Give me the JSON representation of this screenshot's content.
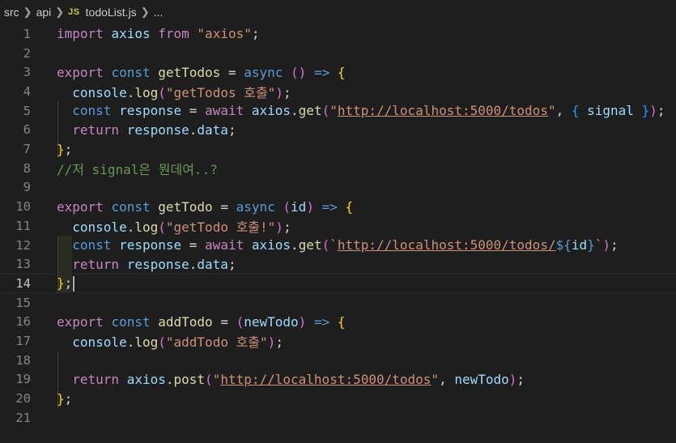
{
  "breadcrumb": {
    "segments": [
      "src",
      "api",
      "todoList.js",
      "..."
    ],
    "file_icon": "JS"
  },
  "editor": {
    "current_line": 14,
    "lines": [
      {
        "n": "1"
      },
      {
        "n": "2"
      },
      {
        "n": "3"
      },
      {
        "n": "4"
      },
      {
        "n": "5"
      },
      {
        "n": "6"
      },
      {
        "n": "7"
      },
      {
        "n": "8"
      },
      {
        "n": "9"
      },
      {
        "n": "10"
      },
      {
        "n": "11"
      },
      {
        "n": "12"
      },
      {
        "n": "13"
      },
      {
        "n": "14"
      },
      {
        "n": "15"
      },
      {
        "n": "16"
      },
      {
        "n": "17"
      },
      {
        "n": "18"
      },
      {
        "n": "19"
      },
      {
        "n": "20"
      },
      {
        "n": "21"
      }
    ],
    "code": [
      [
        [
          "kw-ctl",
          "import"
        ],
        [
          "op",
          " "
        ],
        [
          "var",
          "axios"
        ],
        [
          "op",
          " "
        ],
        [
          "kw-ctl",
          "from"
        ],
        [
          "op",
          " "
        ],
        [
          "str",
          "\"axios\""
        ],
        [
          "op",
          ";"
        ]
      ],
      [],
      [
        [
          "kw-ctl",
          "export"
        ],
        [
          "op",
          " "
        ],
        [
          "kw",
          "const"
        ],
        [
          "op",
          " "
        ],
        [
          "fn",
          "getTodos"
        ],
        [
          "op",
          " = "
        ],
        [
          "kw",
          "async"
        ],
        [
          "op",
          " "
        ],
        [
          "b2",
          "()"
        ],
        [
          "op",
          " "
        ],
        [
          "kw",
          "=>"
        ],
        [
          "op",
          " "
        ],
        [
          "b1",
          "{"
        ]
      ],
      [
        [
          "op",
          "  "
        ],
        [
          "var",
          "console"
        ],
        [
          "op",
          "."
        ],
        [
          "fn",
          "log"
        ],
        [
          "b2",
          "("
        ],
        [
          "str",
          "\"getTodos 호출\""
        ],
        [
          "b2",
          ")"
        ],
        [
          "op",
          ";"
        ]
      ],
      [
        [
          "op",
          "  "
        ],
        [
          "kw",
          "const"
        ],
        [
          "op",
          " "
        ],
        [
          "var",
          "response"
        ],
        [
          "op",
          " = "
        ],
        [
          "kw-ctl",
          "await"
        ],
        [
          "op",
          " "
        ],
        [
          "var",
          "axios"
        ],
        [
          "op",
          "."
        ],
        [
          "fn",
          "get"
        ],
        [
          "b2",
          "("
        ],
        [
          "str",
          "\""
        ],
        [
          "url",
          "http://localhost:5000/todos"
        ],
        [
          "str",
          "\""
        ],
        [
          "op",
          ", "
        ],
        [
          "b3",
          "{"
        ],
        [
          "op",
          " "
        ],
        [
          "var",
          "signal"
        ],
        [
          "op",
          " "
        ],
        [
          "b3",
          "}"
        ],
        [
          "b2",
          ")"
        ],
        [
          "op",
          ";"
        ]
      ],
      [
        [
          "op",
          "  "
        ],
        [
          "kw-ctl",
          "return"
        ],
        [
          "op",
          " "
        ],
        [
          "var",
          "response"
        ],
        [
          "op",
          "."
        ],
        [
          "var",
          "data"
        ],
        [
          "op",
          ";"
        ]
      ],
      [
        [
          "b1",
          "}"
        ],
        [
          "op",
          ";"
        ]
      ],
      [
        [
          "cmt",
          "//저 signal은 뭔데여..?"
        ]
      ],
      [],
      [
        [
          "kw-ctl",
          "export"
        ],
        [
          "op",
          " "
        ],
        [
          "kw",
          "const"
        ],
        [
          "op",
          " "
        ],
        [
          "fn",
          "getTodo"
        ],
        [
          "op",
          " = "
        ],
        [
          "kw",
          "async"
        ],
        [
          "op",
          " "
        ],
        [
          "b2",
          "("
        ],
        [
          "var",
          "id"
        ],
        [
          "b2",
          ")"
        ],
        [
          "op",
          " "
        ],
        [
          "kw",
          "=>"
        ],
        [
          "op",
          " "
        ],
        [
          "b1",
          "{"
        ]
      ],
      [
        [
          "op",
          "  "
        ],
        [
          "var",
          "console"
        ],
        [
          "op",
          "."
        ],
        [
          "fn",
          "log"
        ],
        [
          "b2",
          "("
        ],
        [
          "str",
          "\"getTodo 호출!\""
        ],
        [
          "b2",
          ")"
        ],
        [
          "op",
          ";"
        ]
      ],
      [
        [
          "op",
          "  "
        ],
        [
          "kw",
          "const"
        ],
        [
          "op",
          " "
        ],
        [
          "var",
          "response"
        ],
        [
          "op",
          " = "
        ],
        [
          "kw-ctl",
          "await"
        ],
        [
          "op",
          " "
        ],
        [
          "var",
          "axios"
        ],
        [
          "op",
          "."
        ],
        [
          "fn",
          "get"
        ],
        [
          "b2",
          "("
        ],
        [
          "str",
          "`"
        ],
        [
          "url",
          "http://localhost:5000/todos/"
        ],
        [
          "tpl",
          "${"
        ],
        [
          "var",
          "id"
        ],
        [
          "tpl",
          "}"
        ],
        [
          "str",
          "`"
        ],
        [
          "b2",
          ")"
        ],
        [
          "op",
          ";"
        ]
      ],
      [
        [
          "op",
          "  "
        ],
        [
          "kw-ctl",
          "return"
        ],
        [
          "op",
          " "
        ],
        [
          "var",
          "response"
        ],
        [
          "op",
          "."
        ],
        [
          "var",
          "data"
        ],
        [
          "op",
          ";"
        ]
      ],
      [
        [
          "b1",
          "}"
        ],
        [
          "op",
          ";"
        ]
      ],
      [],
      [
        [
          "kw-ctl",
          "export"
        ],
        [
          "op",
          " "
        ],
        [
          "kw",
          "const"
        ],
        [
          "op",
          " "
        ],
        [
          "fn",
          "addTodo"
        ],
        [
          "op",
          " = "
        ],
        [
          "b2",
          "("
        ],
        [
          "var",
          "newTodo"
        ],
        [
          "b2",
          ")"
        ],
        [
          "op",
          " "
        ],
        [
          "kw",
          "=>"
        ],
        [
          "op",
          " "
        ],
        [
          "b1",
          "{"
        ]
      ],
      [
        [
          "op",
          "  "
        ],
        [
          "var",
          "console"
        ],
        [
          "op",
          "."
        ],
        [
          "fn",
          "log"
        ],
        [
          "b2",
          "("
        ],
        [
          "str",
          "\"addTodo 호출\""
        ],
        [
          "b2",
          ")"
        ],
        [
          "op",
          ";"
        ]
      ],
      [],
      [
        [
          "op",
          "  "
        ],
        [
          "kw-ctl",
          "return"
        ],
        [
          "op",
          " "
        ],
        [
          "var",
          "axios"
        ],
        [
          "op",
          "."
        ],
        [
          "fn",
          "post"
        ],
        [
          "b2",
          "("
        ],
        [
          "str",
          "\""
        ],
        [
          "url",
          "http://localhost:5000/todos"
        ],
        [
          "str",
          "\""
        ],
        [
          "op",
          ", "
        ],
        [
          "var",
          "newTodo"
        ],
        [
          "b2",
          ")"
        ],
        [
          "op",
          ";"
        ]
      ],
      [
        [
          "b1",
          "}"
        ],
        [
          "op",
          ";"
        ]
      ],
      []
    ]
  }
}
